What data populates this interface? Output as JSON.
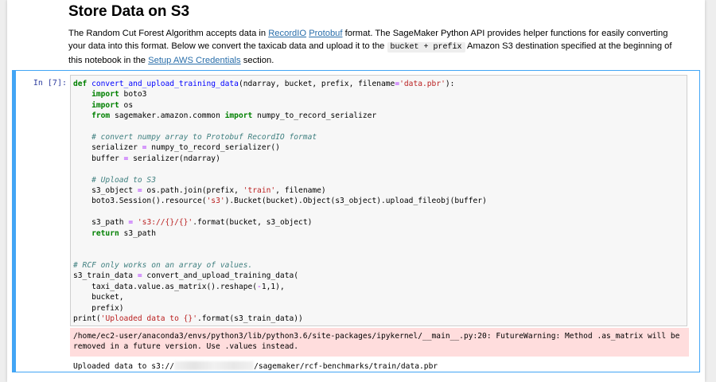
{
  "markdown": {
    "title": "Store Data on S3",
    "para": {
      "p1": "The Random Cut Forest Algorithm accepts data in ",
      "link1": "RecordIO",
      "sp1": " ",
      "link2": "Protobuf",
      "p2": " format. The SageMaker Python API provides helper functions for easily converting your data into this format. Below we convert the taxicab data and upload it to the ",
      "code": "bucket + prefix",
      "p3": " Amazon S3 destination specified at the beginning of this notebook in the ",
      "link3": "Setup AWS Credentials",
      "p4": " section."
    }
  },
  "cell": {
    "prompt": "In [7]:",
    "code": {
      "def": "def",
      "fname": "convert_and_upload_training_data",
      "sig_a": "(ndarray, bucket, prefix, filename",
      "sig_eq": "=",
      "sig_str": "'data.pbr'",
      "sig_b": "):",
      "import": "import",
      "from": "from",
      "boto3": " boto3",
      "os": " os",
      "from_mod": " sagemaker.amazon.common ",
      "serializer_fn": " numpy_to_record_serializer",
      "comment1": "# convert numpy array to Protobuf RecordIO format",
      "ser_lhs": "serializer ",
      "ser_rhs": " numpy_to_record_serializer()",
      "buf_lhs": "buffer ",
      "buf_rhs": " serializer(ndarray)",
      "comment2": "# Upload to S3",
      "obj_lhs": "s3_object ",
      "obj_a": " os.path.join(prefix, ",
      "obj_str": "'train'",
      "obj_b": ", filename)",
      "sess_a": "boto3.Session().resource(",
      "sess_str": "'s3'",
      "sess_b": ").Bucket(bucket).Object(s3_object).upload_fileobj(buffer)",
      "path_lhs": "s3_path ",
      "path_str": "'s3://{}/{}'",
      "path_b": ".format(bucket, s3_object)",
      "return": "return",
      "ret_val": " s3_path",
      "comment3": "# RCF only works on an array of values.",
      "train_lhs": "s3_train_data ",
      "train_rhs": " convert_and_upload_training_data(",
      "arg1_a": "    taxi_data.value.as_matrix().reshape(",
      "arg1_b": "),",
      "arg1_c": "1",
      "arg2": "    bucket,",
      "arg3": "    prefix)",
      "print": "print",
      "print_str": "'Uploaded data to {}'",
      "print_b": ".format(s3_train_data))"
    },
    "stderr": "/home/ec2-user/anaconda3/envs/python3/lib/python3.6/site-packages/ipykernel/__main__.py:20: FutureWarning: Method .as_matrix will be removed in a future version. Use .values instead.",
    "stdout_a": "Uploaded data to s3://",
    "stdout_b": "/sagemaker/rcf-benchmarks/train/data.pbr"
  }
}
